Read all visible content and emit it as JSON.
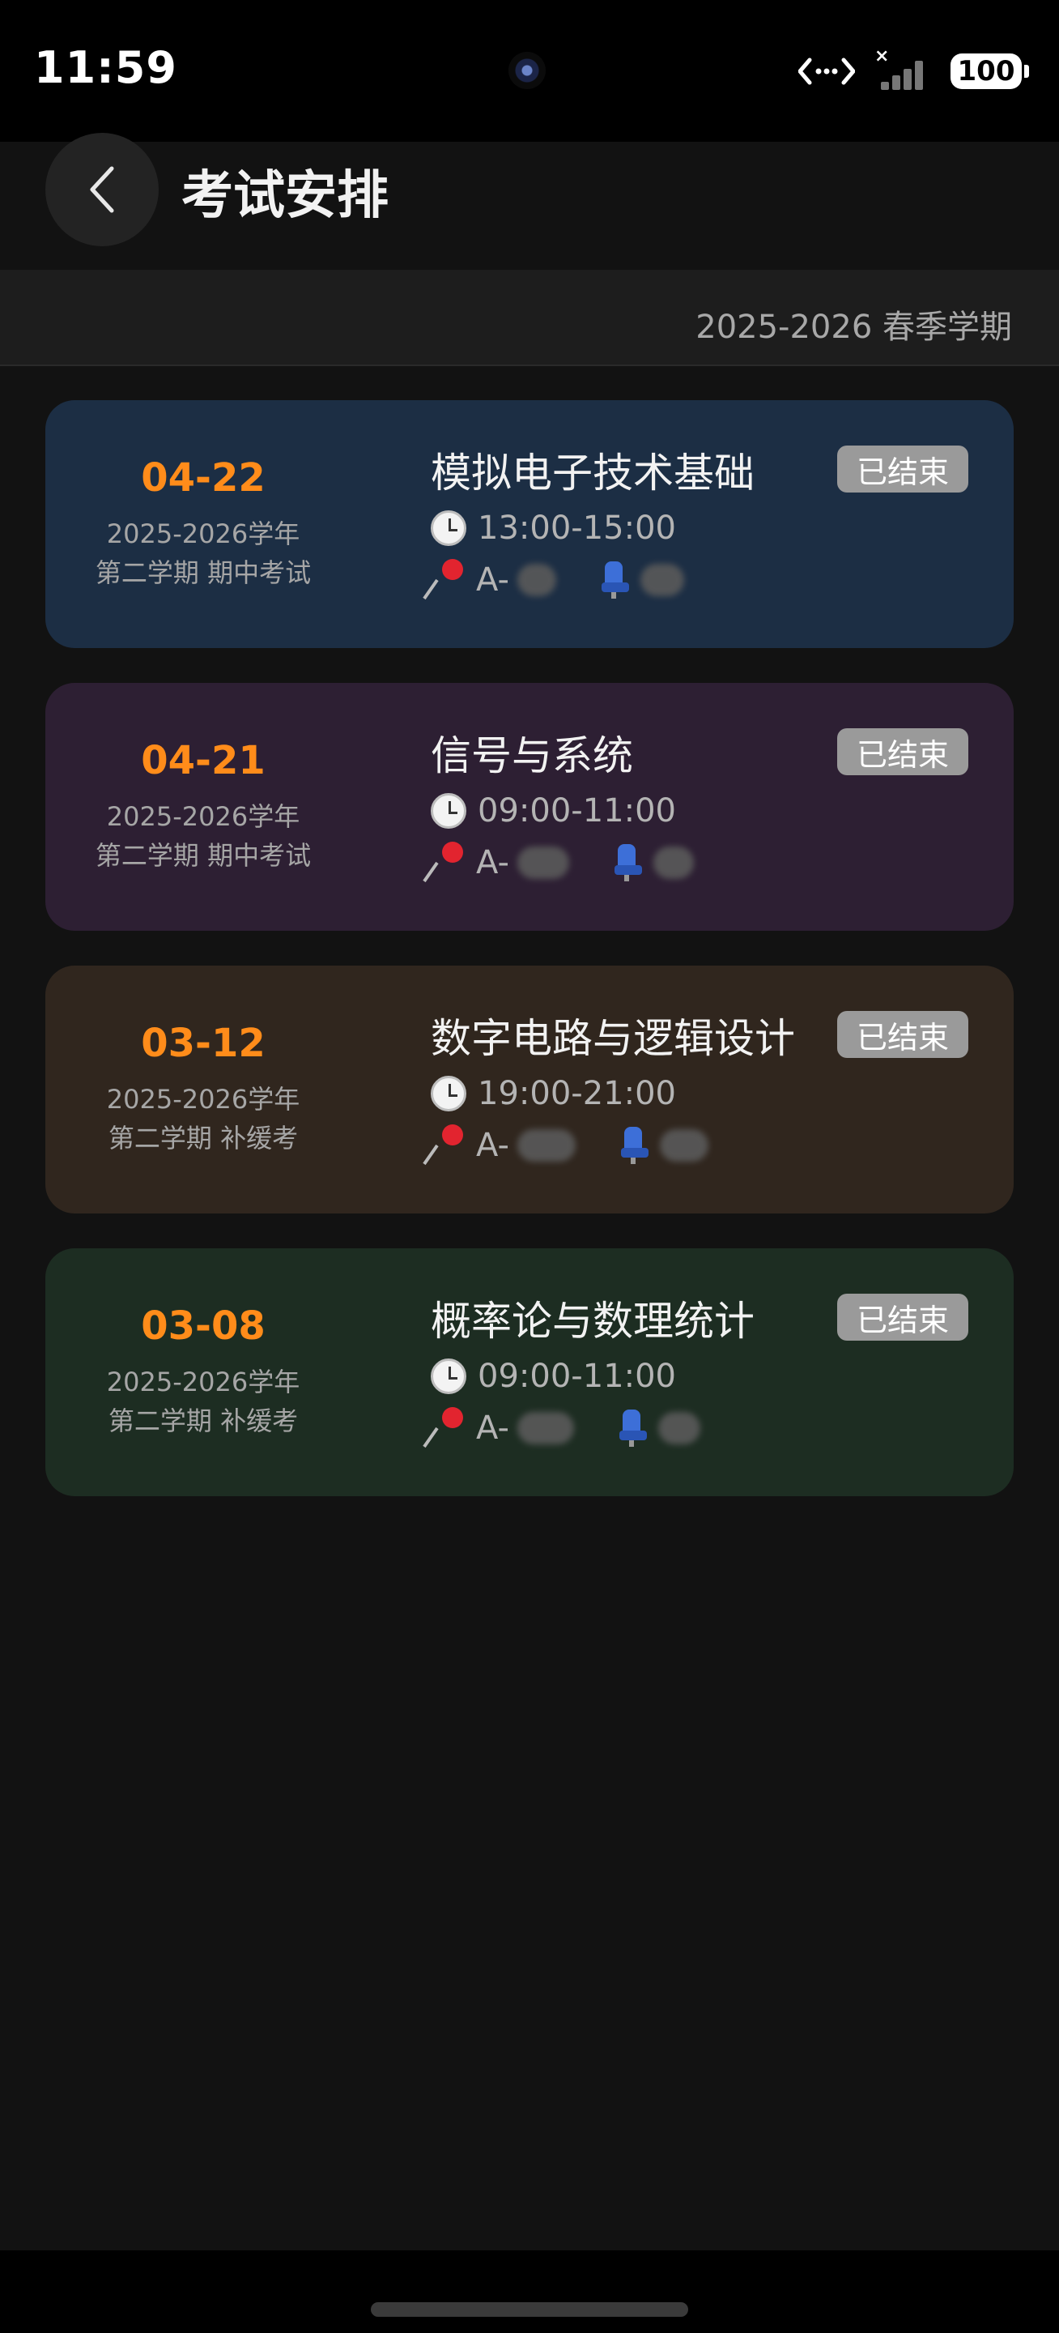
{
  "status_bar": {
    "time": "11:59",
    "battery": "100",
    "icons": [
      "camera-dot",
      "data-transfer-icon",
      "signal-icon",
      "battery-icon"
    ]
  },
  "header": {
    "title": "考试安排",
    "back_icon": "chevron-left-icon"
  },
  "term": "2025-2026 春季学期",
  "exams": [
    {
      "date": "04-22",
      "year": "2025-2026学年",
      "exam_type": "第二学期 期中考试",
      "course": "模拟电子技术基础",
      "status": "已结束",
      "time": "13:00-15:00",
      "location": "A-",
      "color": "#1c2e44"
    },
    {
      "date": "04-21",
      "year": "2025-2026学年",
      "exam_type": "第二学期 期中考试",
      "course": "信号与系统",
      "status": "已结束",
      "time": "09:00-11:00",
      "location": "A-",
      "color": "#2d1f33"
    },
    {
      "date": "03-12",
      "year": "2025-2026学年",
      "exam_type": "第二学期 补缓考",
      "course": "数字电路与逻辑设计",
      "status": "已结束",
      "time": "19:00-21:00",
      "location": "A-",
      "color": "#30261e"
    },
    {
      "date": "03-08",
      "year": "2025-2026学年",
      "exam_type": "第二学期 补缓考",
      "course": "概率论与数理统计",
      "status": "已结束",
      "time": "09:00-11:00",
      "location": "A-",
      "color": "#1d2d22"
    }
  ]
}
